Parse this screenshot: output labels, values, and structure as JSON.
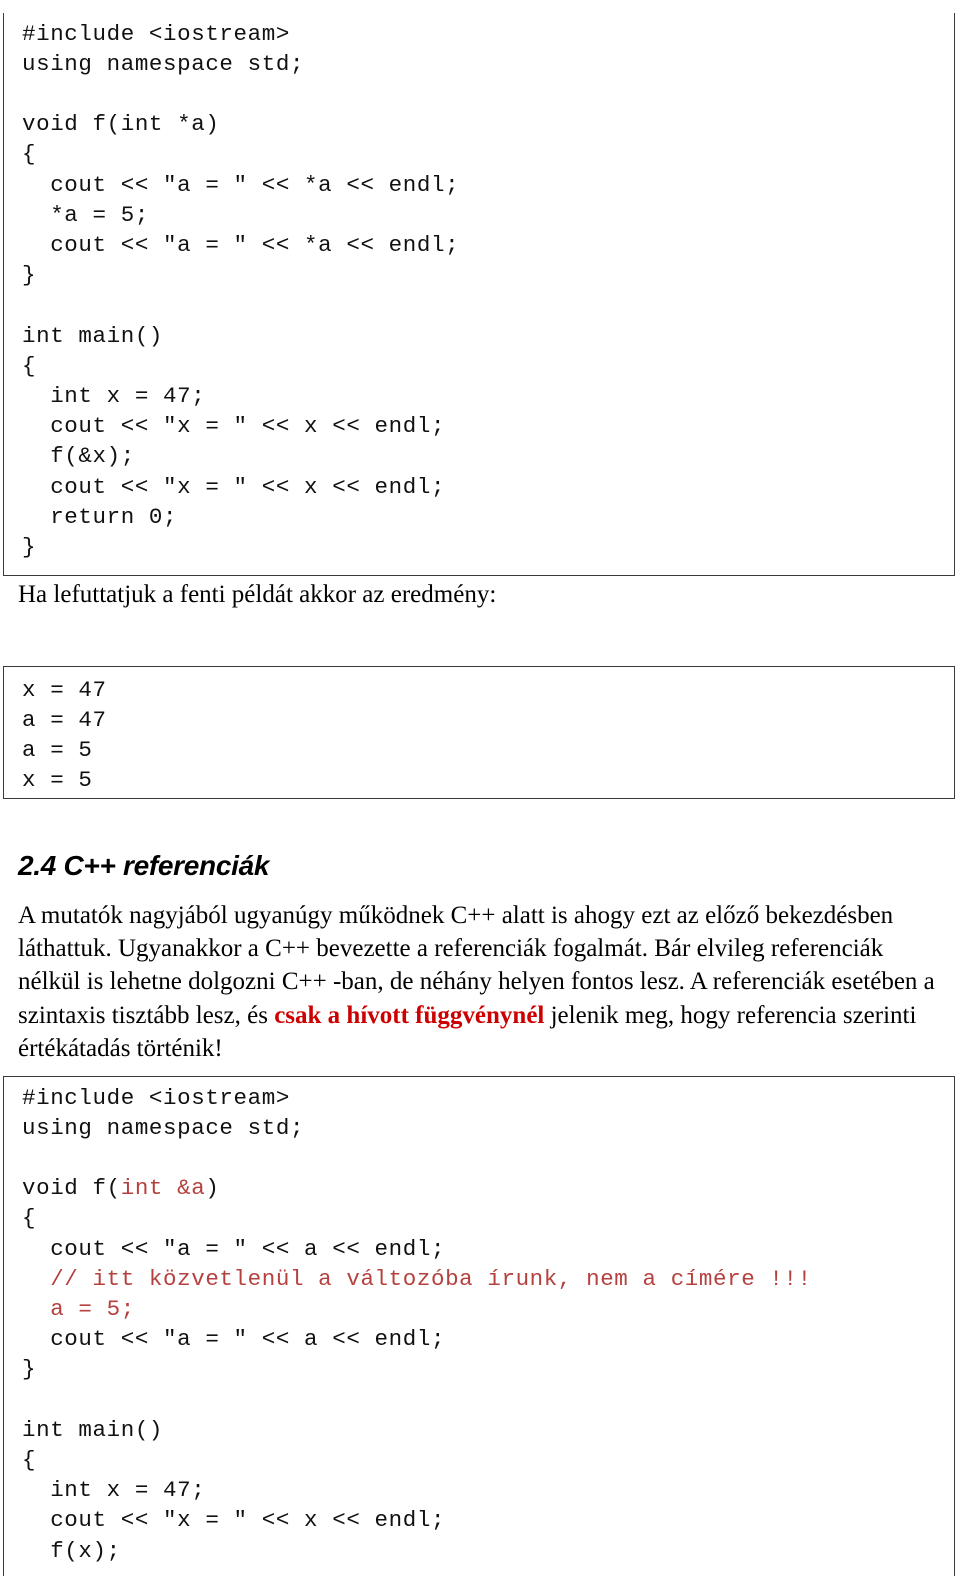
{
  "document": {
    "language": "hu",
    "colors": {
      "text": "#000000",
      "code_text": "#111111",
      "code_red": "#b5413f",
      "emphasis_red": "#cc0000",
      "border": "#3a3a3a",
      "background": "#ffffff"
    }
  },
  "pointer_example": {
    "name": "pointer-code-listing",
    "lines": [
      "#include <iostream>",
      "using namespace std;",
      "",
      "void f(int *a)",
      "{",
      "  cout << \"a = \" << *a << endl;",
      "  *a = 5;",
      "  cout << \"a = \" << *a << endl;",
      "}",
      "",
      "int main()",
      "{",
      "  int x = 47;",
      "  cout << \"x = \" << x << endl;",
      "  f(&x);",
      "  cout << \"x = \" << x << endl;",
      "  return 0;",
      "}"
    ]
  },
  "caption": {
    "text": "Ha lefuttatjuk a fenti példát akkor az eredmény:"
  },
  "program_output": {
    "name": "program-output-listing",
    "lines": [
      "x = 47",
      "a = 47",
      "a = 5",
      "x = 5"
    ]
  },
  "section": {
    "heading": "2.4 C++ referenciák",
    "paragraph": {
      "before_emphasis": "A mutatók nagyjából ugyanúgy működnek C++ alatt is ahogy ezt az előző bekezdésben láthattuk. Ugyanakkor a C++ bevezette a referenciák fogalmát. Bár elvileg referenciák nélkül is lehetne dolgozni C++ -ban, de néhány helyen fontos lesz. A referenciák esetében a szintaxis tisztább lesz, és ",
      "emphasis": "csak a hívott függvénynél",
      "after_emphasis": " jelenik meg, hogy referencia szerinti értékátadás történik!"
    }
  },
  "reference_example": {
    "name": "reference-code-listing",
    "lines": [
      {
        "segments": [
          {
            "text": "#include <iostream>",
            "color": "black"
          }
        ]
      },
      {
        "segments": [
          {
            "text": "using namespace std;",
            "color": "black"
          }
        ]
      },
      {
        "segments": [
          {
            "text": "",
            "color": "black"
          }
        ]
      },
      {
        "segments": [
          {
            "text": "void f(",
            "color": "black"
          },
          {
            "text": "int &a",
            "color": "red"
          },
          {
            "text": ")",
            "color": "black"
          }
        ]
      },
      {
        "segments": [
          {
            "text": "{",
            "color": "black"
          }
        ]
      },
      {
        "segments": [
          {
            "text": "  cout << \"a = \" << a << endl;",
            "color": "black"
          }
        ]
      },
      {
        "segments": [
          {
            "text": "  // itt közvetlenül a változóba írunk, nem a címére !!!",
            "color": "red"
          }
        ]
      },
      {
        "segments": [
          {
            "text": "  a = 5;",
            "color": "red"
          }
        ]
      },
      {
        "segments": [
          {
            "text": "  cout << \"a = \" << a << endl;",
            "color": "black"
          }
        ]
      },
      {
        "segments": [
          {
            "text": "}",
            "color": "black"
          }
        ]
      },
      {
        "segments": [
          {
            "text": "",
            "color": "black"
          }
        ]
      },
      {
        "segments": [
          {
            "text": "int main()",
            "color": "black"
          }
        ]
      },
      {
        "segments": [
          {
            "text": "{",
            "color": "black"
          }
        ]
      },
      {
        "segments": [
          {
            "text": "  int x = 47;",
            "color": "black"
          }
        ]
      },
      {
        "segments": [
          {
            "text": "  cout << \"x = \" << x << endl;",
            "color": "black"
          }
        ]
      },
      {
        "segments": [
          {
            "text": "  f(x);",
            "color": "black"
          }
        ]
      }
    ]
  }
}
